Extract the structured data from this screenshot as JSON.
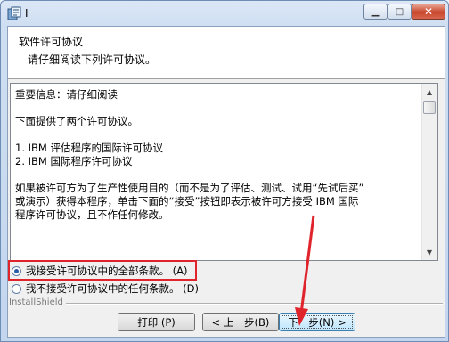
{
  "window": {
    "title": "I"
  },
  "header": {
    "title": "软件许可协议",
    "subtitle": "请仔细阅读下列许可协议。"
  },
  "license": {
    "lines": [
      "重要信息：请仔细阅读",
      "下面提供了两个许可协议。",
      "1. IBM 评估程序的国际许可协议",
      "2. IBM 国际程序许可协议",
      "如果被许可方为了生产性使用目的（而不是为了评估、测试、试用“先试后买”",
      "或演示）获得本程序，单击下面的“接受”按钮即表示被许可方接受 IBM 国际",
      "程序许可协议，且不作任何修改。"
    ]
  },
  "options": {
    "accept": "我接受许可协议中的全部条款。 (A)",
    "decline": "我不接受许可协议中的任何条款。 (D)",
    "selected": "accept"
  },
  "brand": "InstallShield",
  "buttons": {
    "print": "打印 (P)",
    "back": "< 上一步(B)",
    "next": "下一步(N) >"
  },
  "colors": {
    "highlight": "#e0242b",
    "radio_selected": "#2a5ea7"
  }
}
